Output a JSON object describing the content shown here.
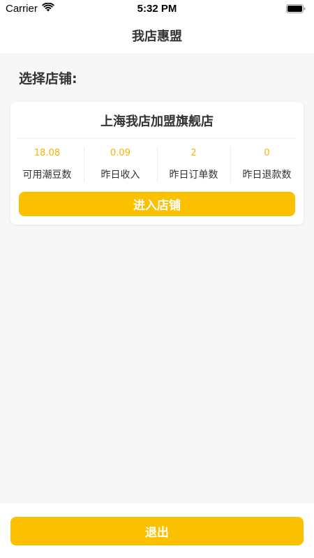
{
  "status_bar": {
    "carrier": "Carrier",
    "time": "5:32 PM",
    "wifi_icon": "wifi-icon",
    "battery_icon": "battery-icon"
  },
  "nav": {
    "title": "我店惠盟"
  },
  "section": {
    "label": "选择店铺:"
  },
  "store": {
    "name": "上海我店加盟旗舰店",
    "stats": [
      {
        "value": "18.08",
        "label": "可用潮豆数"
      },
      {
        "value": "0.09",
        "label": "昨日收入"
      },
      {
        "value": "2",
        "label": "昨日订单数"
      },
      {
        "value": "0",
        "label": "昨日退款数"
      }
    ],
    "enter_label": "进入店铺"
  },
  "footer": {
    "logout_label": "退出"
  },
  "colors": {
    "accent": "#fbc000",
    "stat_value": "#f7b500",
    "background": "#f7f7f7"
  }
}
